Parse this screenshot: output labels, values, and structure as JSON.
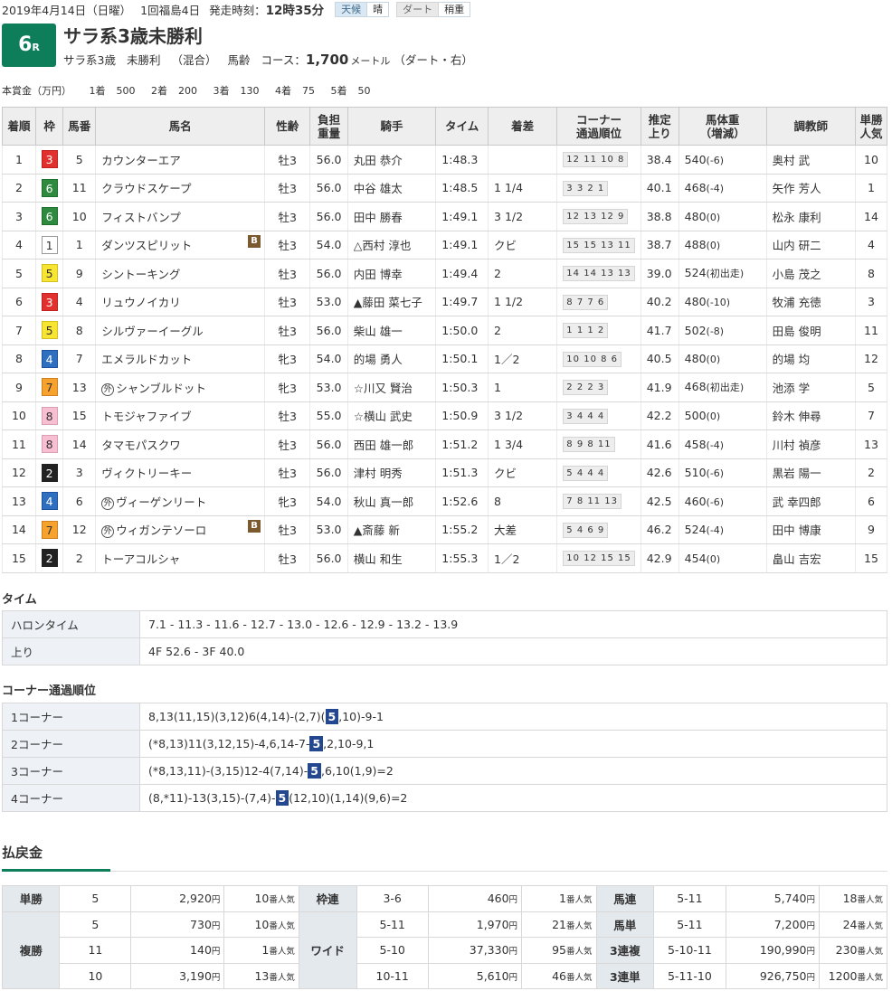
{
  "header": {
    "date": "2019年4月14日（日曜）",
    "meeting": "1回福島4日",
    "post_label": "発走時刻：",
    "post_time": "12時35分",
    "weather_label": "天候",
    "weather": "晴",
    "track_label": "ダート",
    "track_cond": "稍重",
    "race_num": "6",
    "race_suffix": "R",
    "race_name": "サラ系3歳未勝利",
    "cond1": "サラ系3歳",
    "cond2": "未勝利",
    "cond3": "（混合）",
    "cond4": "馬齢",
    "course_label": "コース：",
    "distance": "1,700",
    "dist_unit": "メートル",
    "course_detail": "（ダート・右）"
  },
  "prize": {
    "label": "本賞金（万円）",
    "items": [
      {
        "place": "1着",
        "amount": "500"
      },
      {
        "place": "2着",
        "amount": "200"
      },
      {
        "place": "3着",
        "amount": "130"
      },
      {
        "place": "4着",
        "amount": "75"
      },
      {
        "place": "5着",
        "amount": "50"
      }
    ]
  },
  "results": {
    "headers": {
      "order": "着順",
      "waku": "枠",
      "num": "馬番",
      "name": "馬名",
      "sexage": "性齢",
      "weight1": "負担",
      "weight2": "重量",
      "jockey": "騎手",
      "time": "タイム",
      "margin": "着差",
      "corner1": "コーナー",
      "corner2": "通過順位",
      "last1": "推定",
      "last2": "上り",
      "bw1": "馬体重",
      "bw2": "（増減）",
      "trainer": "調教師",
      "pop1": "単勝",
      "pop2": "人気"
    },
    "rows": [
      {
        "order": "1",
        "waku": "3",
        "num": "5",
        "gai": "",
        "name": "カウンターエア",
        "blinker": "",
        "sexage": "牡3",
        "weight": "56.0",
        "jockey": "丸田 恭介",
        "time": "1:48.3",
        "margin": "",
        "corner": "12 11 10 8",
        "last": "38.4",
        "bw": "540",
        "bwd": "(-6)",
        "trainer": "奥村 武",
        "pop": "10"
      },
      {
        "order": "2",
        "waku": "6",
        "num": "11",
        "gai": "",
        "name": "クラウドスケープ",
        "blinker": "",
        "sexage": "牡3",
        "weight": "56.0",
        "jockey": "中谷 雄太",
        "time": "1:48.5",
        "margin": "1 1/4",
        "corner": "3 3 2 1",
        "last": "40.1",
        "bw": "468",
        "bwd": "(-4)",
        "trainer": "矢作 芳人",
        "pop": "1"
      },
      {
        "order": "3",
        "waku": "6",
        "num": "10",
        "gai": "",
        "name": "フィストバンプ",
        "blinker": "",
        "sexage": "牡3",
        "weight": "56.0",
        "jockey": "田中 勝春",
        "time": "1:49.1",
        "margin": "3 1/2",
        "corner": "12 13 12 9",
        "last": "38.8",
        "bw": "480",
        "bwd": "(0)",
        "trainer": "松永 康利",
        "pop": "14"
      },
      {
        "order": "4",
        "waku": "1",
        "num": "1",
        "gai": "",
        "name": "ダンツスピリット",
        "blinker": "B",
        "sexage": "牡3",
        "weight": "54.0",
        "jockey": "△西村 淳也",
        "time": "1:49.1",
        "margin": "クビ",
        "corner": "15 15 13 11",
        "last": "38.7",
        "bw": "488",
        "bwd": "(0)",
        "trainer": "山内 研二",
        "pop": "4"
      },
      {
        "order": "5",
        "waku": "5",
        "num": "9",
        "gai": "",
        "name": "シントーキング",
        "blinker": "",
        "sexage": "牡3",
        "weight": "56.0",
        "jockey": "内田 博幸",
        "time": "1:49.4",
        "margin": "2",
        "corner": "14 14 13 13",
        "last": "39.0",
        "bw": "524",
        "bwd": "(初出走)",
        "trainer": "小島 茂之",
        "pop": "8"
      },
      {
        "order": "6",
        "waku": "3",
        "num": "4",
        "gai": "",
        "name": "リュウノイカリ",
        "blinker": "",
        "sexage": "牡3",
        "weight": "53.0",
        "jockey": "▲藤田 菜七子",
        "time": "1:49.7",
        "margin": "1 1/2",
        "corner": "8 7 7 6",
        "last": "40.2",
        "bw": "480",
        "bwd": "(-10)",
        "trainer": "牧浦 充徳",
        "pop": "3"
      },
      {
        "order": "7",
        "waku": "5",
        "num": "8",
        "gai": "",
        "name": "シルヴァーイーグル",
        "blinker": "",
        "sexage": "牡3",
        "weight": "56.0",
        "jockey": "柴山 雄一",
        "time": "1:50.0",
        "margin": "2",
        "corner": "1 1 1 2",
        "last": "41.7",
        "bw": "502",
        "bwd": "(-8)",
        "trainer": "田島 俊明",
        "pop": "11"
      },
      {
        "order": "8",
        "waku": "4",
        "num": "7",
        "gai": "",
        "name": "エメラルドカット",
        "blinker": "",
        "sexage": "牝3",
        "weight": "54.0",
        "jockey": "的場 勇人",
        "time": "1:50.1",
        "margin": "1／2",
        "corner": "10 10 8 6",
        "last": "40.5",
        "bw": "480",
        "bwd": "(0)",
        "trainer": "的場 均",
        "pop": "12"
      },
      {
        "order": "9",
        "waku": "7",
        "num": "13",
        "gai": "外",
        "name": "シャンブルドット",
        "blinker": "",
        "sexage": "牝3",
        "weight": "53.0",
        "jockey": "☆川又 賢治",
        "time": "1:50.3",
        "margin": "1",
        "corner": "2 2 2 3",
        "last": "41.9",
        "bw": "468",
        "bwd": "(初出走)",
        "trainer": "池添 学",
        "pop": "5"
      },
      {
        "order": "10",
        "waku": "8",
        "num": "15",
        "gai": "",
        "name": "トモジャファイブ",
        "blinker": "",
        "sexage": "牡3",
        "weight": "55.0",
        "jockey": "☆横山 武史",
        "time": "1:50.9",
        "margin": "3 1/2",
        "corner": "3 4 4 4",
        "last": "42.2",
        "bw": "500",
        "bwd": "(0)",
        "trainer": "鈴木 伸尋",
        "pop": "7"
      },
      {
        "order": "11",
        "waku": "8",
        "num": "14",
        "gai": "",
        "name": "タマモパスクワ",
        "blinker": "",
        "sexage": "牡3",
        "weight": "56.0",
        "jockey": "西田 雄一郎",
        "time": "1:51.2",
        "margin": "1 3/4",
        "corner": "8 9 8 11",
        "last": "41.6",
        "bw": "458",
        "bwd": "(-4)",
        "trainer": "川村 禎彦",
        "pop": "13"
      },
      {
        "order": "12",
        "waku": "2",
        "num": "3",
        "gai": "",
        "name": "ヴィクトリーキー",
        "blinker": "",
        "sexage": "牡3",
        "weight": "56.0",
        "jockey": "津村 明秀",
        "time": "1:51.3",
        "margin": "クビ",
        "corner": "5 4 4 4",
        "last": "42.6",
        "bw": "510",
        "bwd": "(-6)",
        "trainer": "黒岩 陽一",
        "pop": "2"
      },
      {
        "order": "13",
        "waku": "4",
        "num": "6",
        "gai": "外",
        "name": "ヴィーゲンリート",
        "blinker": "",
        "sexage": "牝3",
        "weight": "54.0",
        "jockey": "秋山 真一郎",
        "time": "1:52.6",
        "margin": "8",
        "corner": "7 8 11 13",
        "last": "42.5",
        "bw": "460",
        "bwd": "(-6)",
        "trainer": "武 幸四郎",
        "pop": "6"
      },
      {
        "order": "14",
        "waku": "7",
        "num": "12",
        "gai": "外",
        "name": "ウィガンテソーロ",
        "blinker": "B",
        "sexage": "牡3",
        "weight": "53.0",
        "jockey": "▲斎藤 新",
        "time": "1:55.2",
        "margin": "大差",
        "corner": "5 4 6 9",
        "last": "46.2",
        "bw": "524",
        "bwd": "(-4)",
        "trainer": "田中 博康",
        "pop": "9"
      },
      {
        "order": "15",
        "waku": "2",
        "num": "2",
        "gai": "",
        "name": "トーアコルシャ",
        "blinker": "",
        "sexage": "牡3",
        "weight": "56.0",
        "jockey": "横山 和生",
        "time": "1:55.3",
        "margin": "1／2",
        "corner": "10 12 15 15",
        "last": "42.9",
        "bw": "454",
        "bwd": "(0)",
        "trainer": "畠山 吉宏",
        "pop": "15"
      }
    ]
  },
  "timing": {
    "title": "タイム",
    "furlong_label": "ハロンタイム",
    "furlong": "7.1 - 11.3 - 11.6 - 12.7 - 13.0 - 12.6 - 12.9 - 13.2 - 13.9",
    "last_label": "上り",
    "last": "4F 52.6 - 3F 40.0"
  },
  "corners": {
    "title": "コーナー通過順位",
    "rows": [
      {
        "label": "1コーナー",
        "pre": "8,13(11,15)(3,12)6(4,14)-(2,7)(",
        "hl": "5",
        "post": ",10)-9-1"
      },
      {
        "label": "2コーナー",
        "pre": "(*8,13)11(3,12,15)-4,6,14-7-",
        "hl": "5",
        "post": ",2,10-9,1"
      },
      {
        "label": "3コーナー",
        "pre": "(*8,13,11)-(3,15)12-4(7,14)-",
        "hl": "5",
        "post": ",6,10(1,9)=2"
      },
      {
        "label": "4コーナー",
        "pre": "(8,*11)-13(3,15)-(7,4)-",
        "hl": "5",
        "post": "(12,10)(1,14)(9,6)=2"
      }
    ]
  },
  "payout": {
    "title": "払戻金",
    "yen": "円",
    "pop_suffix": "番人気",
    "tansho": {
      "label": "単勝",
      "num": "5",
      "amount": "2,920",
      "pop": "10"
    },
    "fukusho": {
      "label": "複勝",
      "rows": [
        {
          "num": "5",
          "amount": "730",
          "pop": "10"
        },
        {
          "num": "11",
          "amount": "140",
          "pop": "1"
        },
        {
          "num": "10",
          "amount": "3,190",
          "pop": "13"
        }
      ]
    },
    "wakuren": {
      "label": "枠連",
      "num": "3-6",
      "amount": "460",
      "pop": "1"
    },
    "wide": {
      "label": "ワイド",
      "rows": [
        {
          "num": "5-11",
          "amount": "1,970",
          "pop": "21"
        },
        {
          "num": "5-10",
          "amount": "37,330",
          "pop": "95"
        },
        {
          "num": "10-11",
          "amount": "5,610",
          "pop": "46"
        }
      ]
    },
    "umaren": {
      "label": "馬連",
      "num": "5-11",
      "amount": "5,740",
      "pop": "18"
    },
    "umatan": {
      "label": "馬単",
      "num": "5-11",
      "amount": "7,200",
      "pop": "24"
    },
    "sanrenpuku": {
      "label": "3連複",
      "num": "5-10-11",
      "amount": "190,990",
      "pop": "230"
    },
    "sanrentan": {
      "label": "3連単",
      "num": "5-11-10",
      "amount": "926,750",
      "pop": "1200"
    }
  }
}
